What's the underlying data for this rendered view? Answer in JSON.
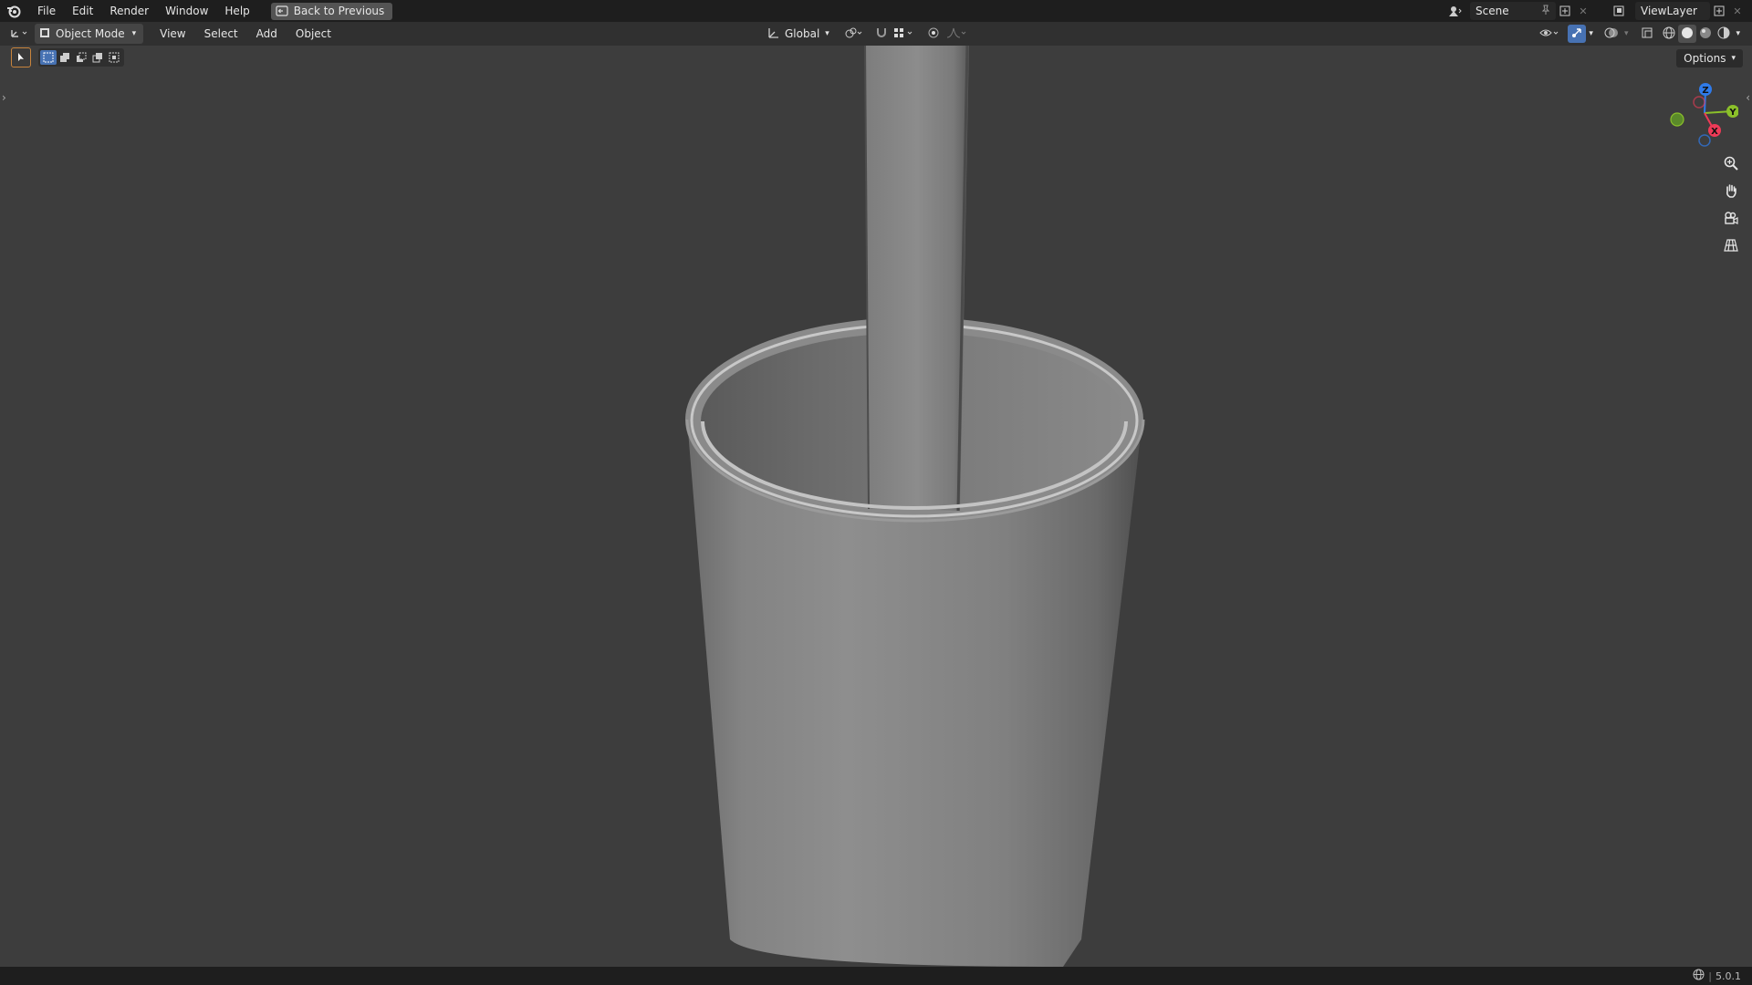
{
  "topbar": {
    "menus": [
      "File",
      "Edit",
      "Render",
      "Window",
      "Help"
    ],
    "back_label": "Back to Previous",
    "scene_name": "Scene",
    "view_layer": "ViewLayer"
  },
  "header": {
    "mode": "Object Mode",
    "menus": [
      "View",
      "Select",
      "Add",
      "Object"
    ],
    "transform_orientation": "Global"
  },
  "viewport": {
    "options_label": "Options",
    "gizmo": {
      "z": "Z",
      "y": "Y",
      "x": "X"
    }
  },
  "status": {
    "version": "5.0.1"
  },
  "icons": {
    "app_logo": "blender-logo-icon",
    "back": "back-icon",
    "editor_type": "3d-viewport-icon",
    "zoom": "zoom-icon",
    "pan": "hand-icon",
    "camera": "camera-icon",
    "perspective": "grid-icon"
  },
  "colors": {
    "accent": "#4772b3",
    "axis_x": "#ee3a57",
    "axis_y": "#8bc02a",
    "axis_z": "#2f7bea"
  }
}
